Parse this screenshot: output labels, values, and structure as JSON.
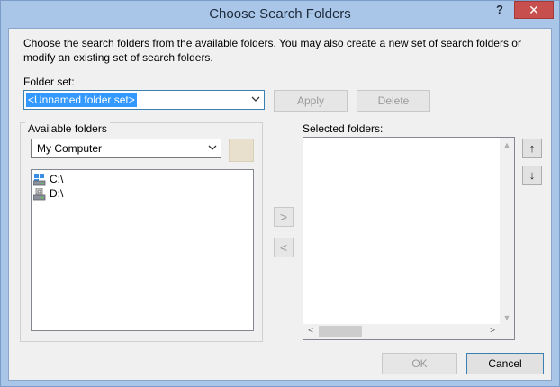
{
  "window": {
    "title": "Choose Search Folders",
    "help_label": "?",
    "close_label": "✕"
  },
  "description": "Choose the search folders from the available folders. You may also create a new set of search folders or modify an existing set of search folders.",
  "folder_set": {
    "label": "Folder set:",
    "value": "<Unnamed folder set>",
    "apply_label": "Apply",
    "delete_label": "Delete"
  },
  "available": {
    "group_label": "Available folders",
    "source_value": "My Computer",
    "items": [
      {
        "label": "C:\\",
        "icon": "windows-drive-icon"
      },
      {
        "label": "D:\\",
        "icon": "drive-icon"
      }
    ]
  },
  "transfer": {
    "add_label": ">",
    "remove_label": "<"
  },
  "selected": {
    "label": "Selected folders:"
  },
  "order": {
    "up_label": "↑",
    "down_label": "↓"
  },
  "footer": {
    "ok_label": "OK",
    "cancel_label": "Cancel"
  }
}
